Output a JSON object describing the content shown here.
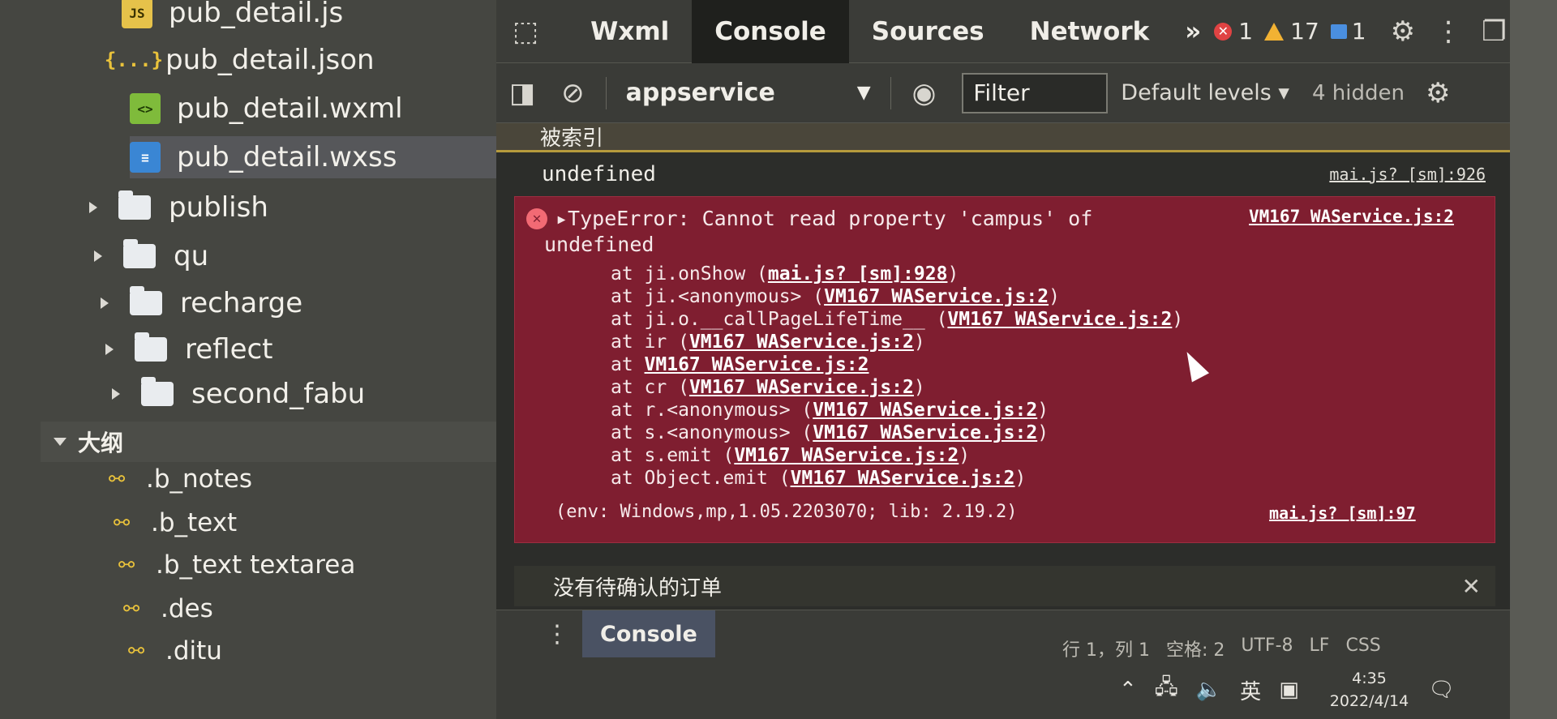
{
  "explorer": {
    "files": [
      {
        "name": "pub_detail.js",
        "icon": "js-file-icon",
        "badge": "JS"
      },
      {
        "name": "pub_detail.json",
        "icon": "json-file-icon",
        "badge": "{...}"
      },
      {
        "name": "pub_detail.wxml",
        "icon": "wxml-file-icon",
        "badge": "<>"
      },
      {
        "name": "pub_detail.wxss",
        "icon": "wxss-file-icon",
        "badge": "≡"
      }
    ],
    "folders": [
      "publish",
      "qu",
      "recharge",
      "reflect",
      "second_fabu"
    ],
    "outline_title": "大纲",
    "outline_items": [
      ".b_notes",
      ".b_text",
      ".b_text textarea",
      ".des",
      ".ditu"
    ]
  },
  "devtools": {
    "tabs": [
      "Wxml",
      "Console",
      "Sources",
      "Network"
    ],
    "active_tab": "Console",
    "more_tabs": "»",
    "counts": {
      "errors": "1",
      "warnings": "17",
      "info": "1"
    },
    "toolbar": {
      "context": "appservice",
      "filter_placeholder": "Filter",
      "levels": "Default levels ▾",
      "hidden": "4 hidden"
    },
    "console": {
      "top_line": "被索引",
      "undefined_line": "undefined",
      "undefined_source": "mai.js? [sm]:926",
      "error": {
        "head": "▸TypeError: Cannot read property 'campus' of",
        "head2": "undefined",
        "source": "VM167 WAService.js:2",
        "stack": [
          {
            "pre": "at ji.onShow (",
            "link": "mai.js? [sm]:928",
            "post": ")"
          },
          {
            "pre": "at ji.<anonymous> (",
            "link": "VM167 WAService.js:2",
            "post": ")"
          },
          {
            "pre": "at ji.o.__callPageLifeTime__ (",
            "link": "VM167 WAService.js:2",
            "post": ")"
          },
          {
            "pre": "at ir (",
            "link": "VM167 WAService.js:2",
            "post": ")"
          },
          {
            "pre": "at ",
            "link": "VM167 WAService.js:2",
            "post": ""
          },
          {
            "pre": "at cr (",
            "link": "VM167 WAService.js:2",
            "post": ")"
          },
          {
            "pre": "at r.<anonymous> (",
            "link": "VM167 WAService.js:2",
            "post": ")"
          },
          {
            "pre": "at s.<anonymous> (",
            "link": "VM167 WAService.js:2",
            "post": ")"
          },
          {
            "pre": "at s.emit (",
            "link": "VM167 WAService.js:2",
            "post": ")"
          },
          {
            "pre": "at Object.emit (",
            "link": "VM167 WAService.js:2",
            "post": ")"
          }
        ],
        "env": "(env: Windows,mp,1.05.2203070; lib: 2.19.2)",
        "env_source": "mai.js? [sm]:97"
      },
      "message": "没有待确认的订单"
    },
    "drawer_tab": "Console"
  },
  "statusbar": [
    "行 1，列 1",
    "空格: 2",
    "UTF-8",
    "LF",
    "CSS"
  ],
  "taskbar": {
    "ime": "英",
    "time": "4:35",
    "date": "2022/4/14"
  },
  "colors": {
    "error_bg": "#7f1e30",
    "warning_yellow": "#f2b233",
    "error_red": "#e04343"
  }
}
